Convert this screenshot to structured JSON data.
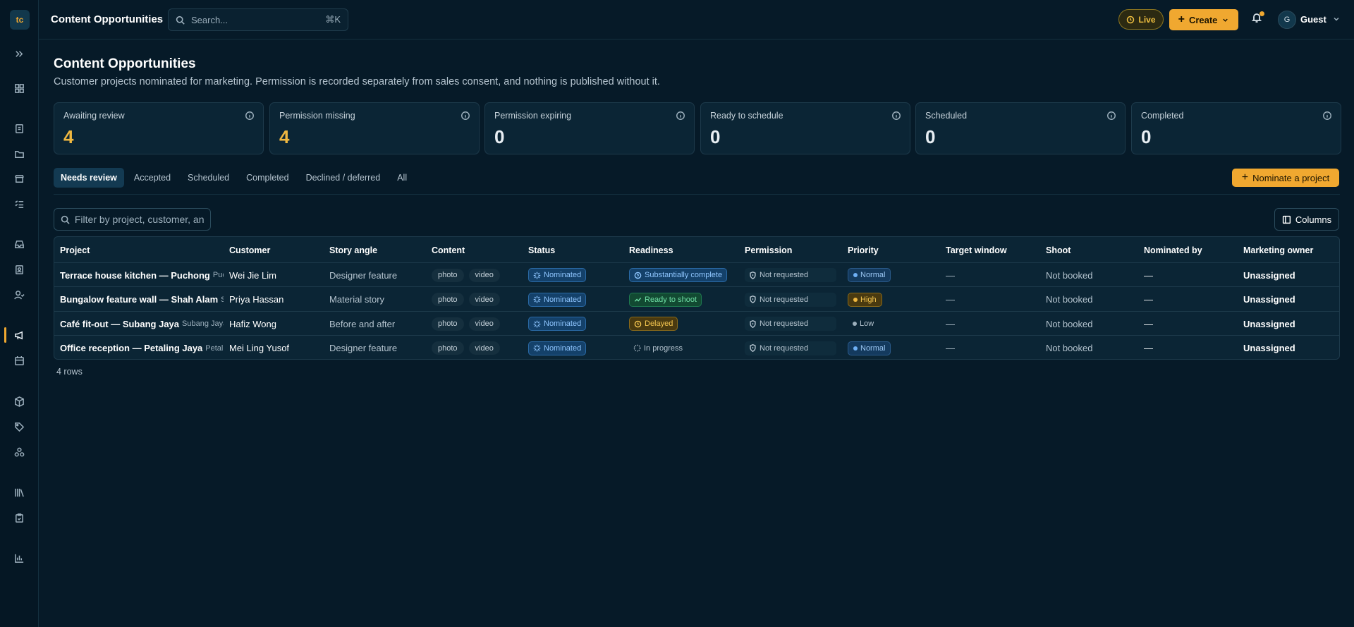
{
  "app": {
    "logo": "tc",
    "title": "Content Opportunities",
    "search_placeholder": "Search...",
    "search_shortcut": "⌘K",
    "live_label": "Live",
    "create_label": "Create",
    "user_initial": "G",
    "user_name": "Guest"
  },
  "sidebar": {
    "icons": [
      "expand-icon",
      "dashboard-icon",
      "document-icon",
      "folder-icon",
      "store-icon",
      "checklist-icon",
      "inbox-icon",
      "contact-card-icon",
      "user-check-icon",
      "megaphone-icon",
      "calendar-icon",
      "package-icon",
      "tag-icon",
      "cluster-icon",
      "library-icon",
      "clipboard-check-icon",
      "bar-chart-icon"
    ],
    "active": "megaphone-icon"
  },
  "page": {
    "title": "Content Opportunities",
    "subtitle": "Customer projects nominated for marketing. Permission is recorded separately from sales consent, and nothing is published without it."
  },
  "stats": [
    {
      "label": "Awaiting review",
      "value": "4",
      "highlight": true
    },
    {
      "label": "Permission missing",
      "value": "4",
      "highlight": true
    },
    {
      "label": "Permission expiring",
      "value": "0",
      "highlight": false
    },
    {
      "label": "Ready to schedule",
      "value": "0",
      "highlight": false
    },
    {
      "label": "Scheduled",
      "value": "0",
      "highlight": false
    },
    {
      "label": "Completed",
      "value": "0",
      "highlight": false
    }
  ],
  "tabs": [
    {
      "label": "Needs review",
      "active": true
    },
    {
      "label": "Accepted",
      "active": false
    },
    {
      "label": "Scheduled",
      "active": false
    },
    {
      "label": "Completed",
      "active": false
    },
    {
      "label": "Declined / deferred",
      "active": false
    },
    {
      "label": "All",
      "active": false
    }
  ],
  "nominate_label": "Nominate a project",
  "filter_placeholder": "Filter by project, customer, and more",
  "columns_label": "Columns",
  "table": {
    "headers": [
      "Project",
      "Customer",
      "Story angle",
      "Content",
      "Status",
      "Readiness",
      "Permission",
      "Priority",
      "Target window",
      "Shoot",
      "Nominated by",
      "Marketing owner"
    ],
    "rows": [
      {
        "project": "Terrace house kitchen — Puchong",
        "location": "Puchong",
        "customer": "Wei Jie Lim",
        "angle": "Designer feature",
        "content": [
          "photo",
          "video"
        ],
        "status": "Nominated",
        "readiness": "Substantially complete",
        "readiness_kind": "substantial",
        "permission": "Not requested",
        "priority": "Normal",
        "priority_kind": "normal",
        "target": "—",
        "shoot": "Not booked",
        "nominated_by": "—",
        "owner": "Unassigned"
      },
      {
        "project": "Bungalow feature wall — Shah Alam",
        "location": "Shah Alam",
        "customer": "Priya Hassan",
        "angle": "Material story",
        "content": [
          "photo",
          "video"
        ],
        "status": "Nominated",
        "readiness": "Ready to shoot",
        "readiness_kind": "ready",
        "permission": "Not requested",
        "priority": "High",
        "priority_kind": "high",
        "target": "—",
        "shoot": "Not booked",
        "nominated_by": "—",
        "owner": "Unassigned"
      },
      {
        "project": "Café fit-out — Subang Jaya",
        "location": "Subang Jaya",
        "customer": "Hafiz Wong",
        "angle": "Before and after",
        "content": [
          "photo",
          "video"
        ],
        "status": "Nominated",
        "readiness": "Delayed",
        "readiness_kind": "delayed",
        "permission": "Not requested",
        "priority": "Low",
        "priority_kind": "low",
        "target": "—",
        "shoot": "Not booked",
        "nominated_by": "—",
        "owner": "Unassigned"
      },
      {
        "project": "Office reception — Petaling Jaya",
        "location": "Petaling Jaya",
        "customer": "Mei Ling Yusof",
        "angle": "Designer feature",
        "content": [
          "photo",
          "video"
        ],
        "status": "Nominated",
        "readiness": "In progress",
        "readiness_kind": "progress",
        "permission": "Not requested",
        "priority": "Normal",
        "priority_kind": "normal",
        "target": "—",
        "shoot": "Not booked",
        "nominated_by": "—",
        "owner": "Unassigned"
      }
    ]
  },
  "rows_count": "4 rows",
  "colors": {
    "accent": "#f0a830",
    "background": "#061a28",
    "panel": "#0b2535"
  }
}
